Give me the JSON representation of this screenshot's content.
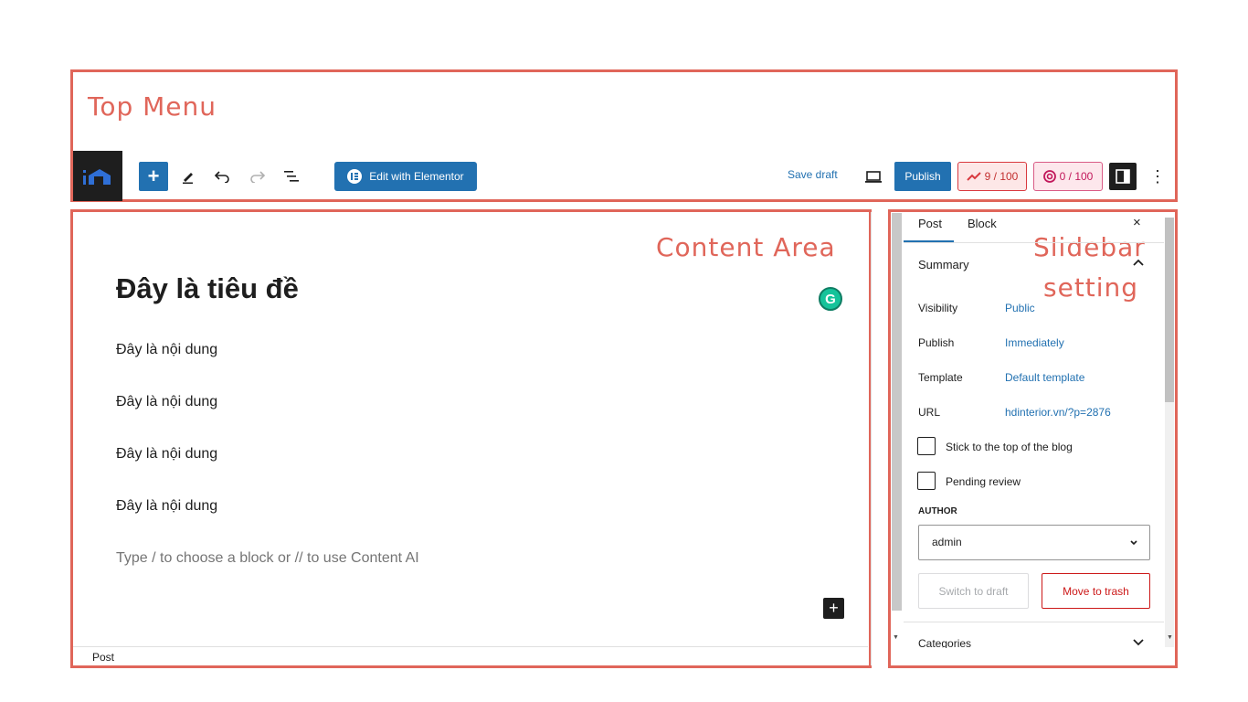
{
  "annotations": {
    "top_menu": "Top Menu",
    "content_area": "Content Area",
    "sidebar_line1": "Slidebar",
    "sidebar_line2": "setting"
  },
  "toolbar": {
    "logo_icon": "site-logo-icon",
    "add_label": "+",
    "edit_elementor_label": "Edit with Elementor",
    "save_draft_label": "Save draft",
    "publish_label": "Publish",
    "seo_score": "9 / 100",
    "content_score": "0 / 100",
    "more_label": "⋮",
    "icons": [
      "plus-icon",
      "pen-icon",
      "undo-icon",
      "redo-icon",
      "list-view-icon",
      "preview-icon",
      "settings-icon",
      "more-icon"
    ]
  },
  "editor": {
    "title": "Đây là tiêu đề",
    "paragraphs": [
      "Đây là nội dung",
      "Đây là nội dung",
      "Đây là nội dung",
      "Đây là nội dung"
    ],
    "placeholder": "Type / to choose a block or // to use Content AI",
    "footer_breadcrumb": "Post",
    "inserter_label": "+",
    "grammarly_label": "G"
  },
  "sidebar": {
    "tabs": [
      "Post",
      "Block"
    ],
    "close_label": "×",
    "summary_title": "Summary",
    "visibility_key": "Visibility",
    "visibility_val": "Public",
    "publish_key": "Publish",
    "publish_val": "Immediately",
    "template_key": "Template",
    "template_val": "Default template",
    "url_key": "URL",
    "url_val": "hdinterior.vn/?p=2876",
    "stick_label": "Stick to the top of the blog",
    "pending_label": "Pending review",
    "author_heading": "AUTHOR",
    "author_value": "admin",
    "switch_draft_label": "Switch to draft",
    "move_trash_label": "Move to trash",
    "categories_label": "Categories"
  },
  "colors": {
    "annotation": "#e0665a",
    "wp_blue": "#2271b1",
    "danger": "#cc1818"
  }
}
